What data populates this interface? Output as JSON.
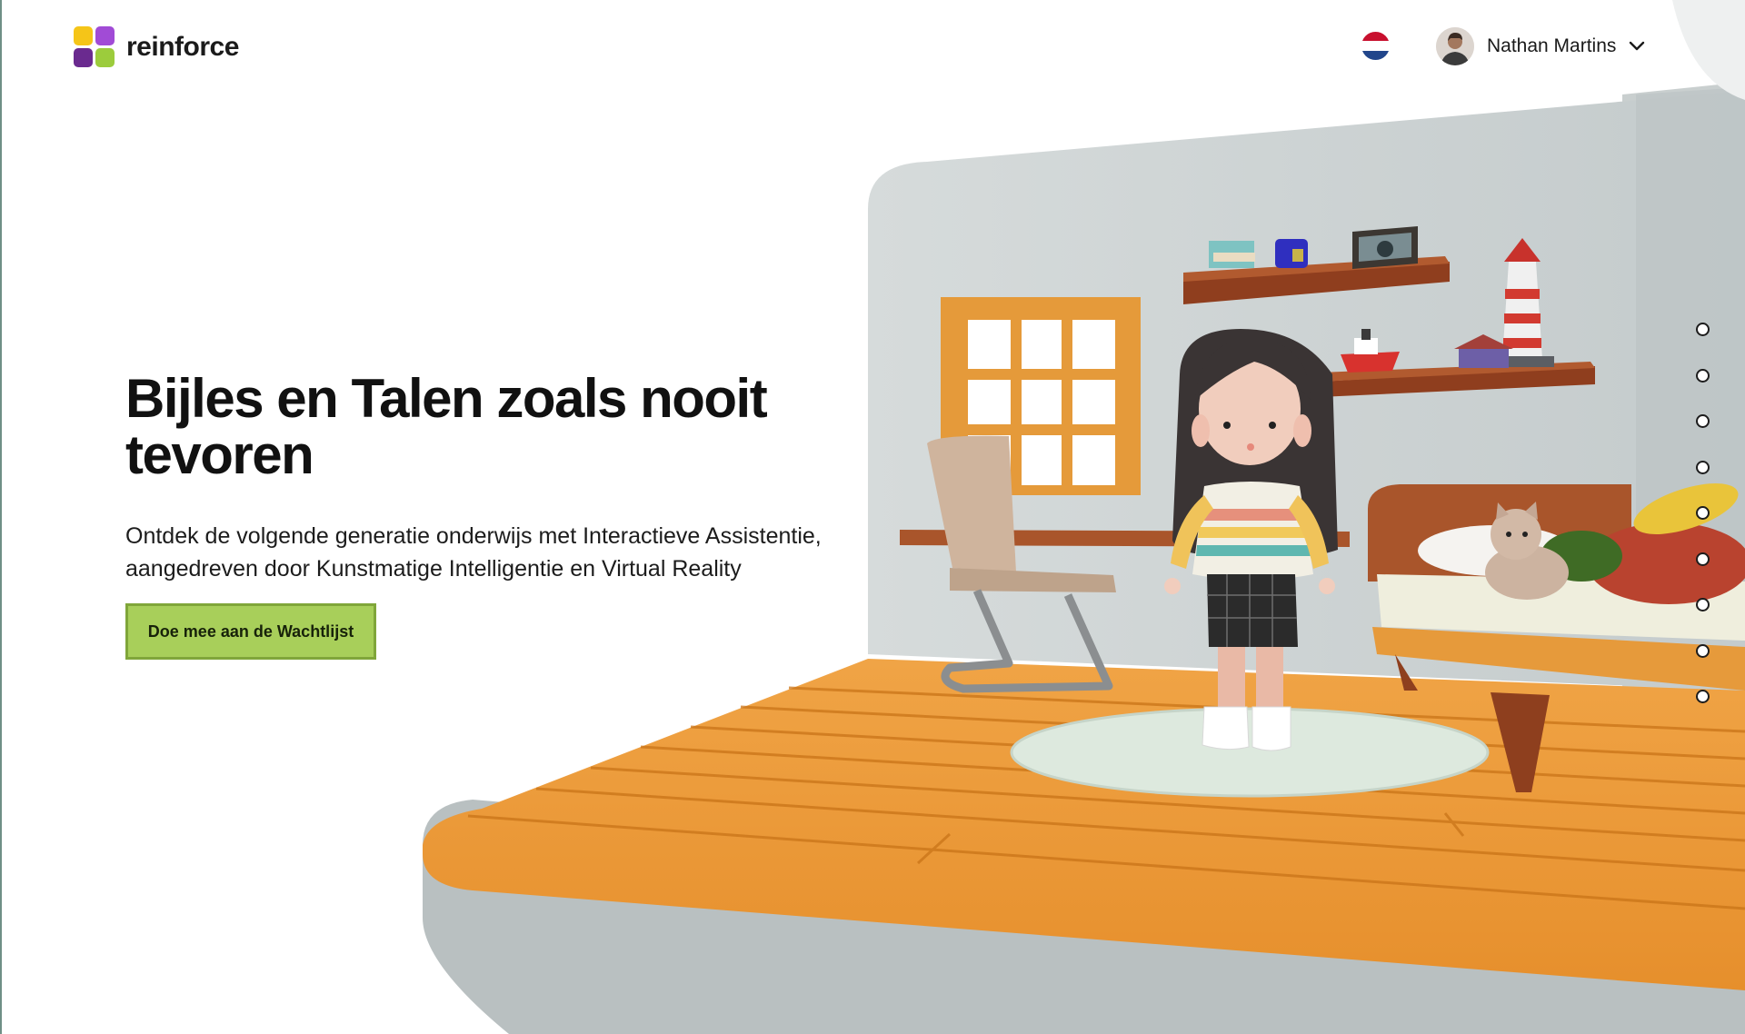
{
  "brand": {
    "name": "reinforce",
    "colors": [
      "#f5c518",
      "#a14bd6",
      "#6a2a8f",
      "#9ccc3c"
    ]
  },
  "header": {
    "language_flag": {
      "icon": "netherlands-flag-icon",
      "colors": [
        "#c8102e",
        "#ffffff",
        "#21468b"
      ]
    },
    "user": {
      "name": "Nathan Martins",
      "menu_icon": "chevron-down-icon"
    }
  },
  "hero": {
    "title": "Bijles en Talen zoals nooit tevoren",
    "subtitle": "Ontdek de volgende generatie onderwijs met Interactieve Assistentie, aangedreven door Kunstmatige Intelligentie en Virtual Reality",
    "cta_label": "Doe mee aan de Wachtlijst",
    "cta_color": "#a8cf5a"
  },
  "slider": {
    "count": 9
  }
}
